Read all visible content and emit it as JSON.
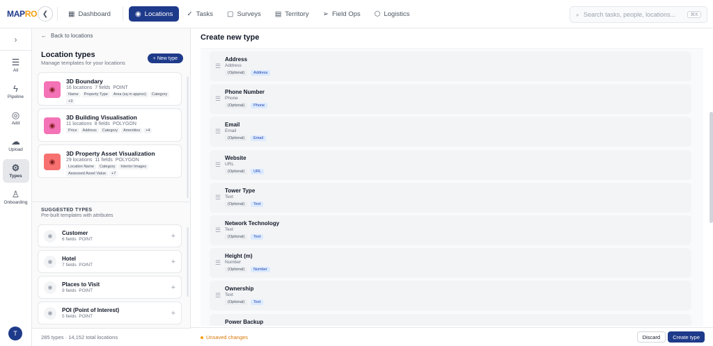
{
  "brand": {
    "logo_main": "MAP",
    "logo_accent": "RO"
  },
  "nav": {
    "back_icon": "chevron-left-icon",
    "tabs": [
      {
        "label": "Dashboard",
        "icon": "dashboard-icon",
        "active": false
      },
      {
        "label": "Locations",
        "icon": "location-pin-icon",
        "active": true
      },
      {
        "label": "Tasks",
        "icon": "check-icon",
        "active": false
      },
      {
        "label": "Surveys",
        "icon": "clipboard-icon",
        "active": false
      },
      {
        "label": "Territory",
        "icon": "map-icon",
        "active": false
      },
      {
        "label": "Field Ops",
        "icon": "send-icon",
        "active": false
      },
      {
        "label": "Logistics",
        "icon": "box-icon",
        "active": false
      }
    ]
  },
  "search": {
    "placeholder": "Search tasks, people, locations...",
    "shortcut": "⌘K"
  },
  "rail": {
    "items": [
      {
        "label": "All",
        "icon": "list-icon"
      },
      {
        "label": "Pipeline",
        "icon": "bolt-icon"
      },
      {
        "label": "Add",
        "icon": "pin-add-icon"
      },
      {
        "label": "Upload",
        "icon": "cloud-upload-icon"
      },
      {
        "label": "Types",
        "icon": "gear-icon"
      },
      {
        "label": "Onboarding",
        "icon": "user-add-icon"
      }
    ],
    "avatar": "T"
  },
  "left_panel": {
    "back_label": "Back to locations",
    "title": "Location types",
    "subtitle": "Manage templates for your locations",
    "new_type_label": "+ New type",
    "types": [
      {
        "name": "3D Boundary",
        "locations": "16 locations",
        "fields": "7 fields",
        "geometry": "POINT",
        "chips": [
          "Name",
          "Property Type",
          "Area (sq m approx)",
          "Category",
          "+3"
        ],
        "color": "#f472b6"
      },
      {
        "name": "3D Building Visualisation",
        "locations": "11 locations",
        "fields": "8 fields",
        "geometry": "POLYGON",
        "chips": [
          "Price",
          "Address",
          "Category",
          "Amenities",
          "+4"
        ],
        "color": "#f472b6"
      },
      {
        "name": "3D Property Asset Visualization",
        "locations": "29 locations",
        "fields": "11 fields",
        "geometry": "POLYGON",
        "chips": [
          "Location Name",
          "Category",
          "Interior Images",
          "Assessed Asset Value",
          "+7"
        ],
        "color": "#f87171"
      }
    ],
    "suggested_title": "SUGGESTED TYPES",
    "suggested_subtitle": "Pre-built templates with attributes",
    "suggested": [
      {
        "name": "Customer",
        "fields": "6 fields",
        "geometry": "POINT"
      },
      {
        "name": "Hotel",
        "fields": "7 fields",
        "geometry": "POINT"
      },
      {
        "name": "Places to Visit",
        "fields": "9 fields",
        "geometry": "POINT"
      },
      {
        "name": "POI (Point of Interest)",
        "fields": "5 fields",
        "geometry": "POINT"
      }
    ],
    "footer": "285 types · 14,152 total locations"
  },
  "main": {
    "title": "Create new type",
    "fields": [
      {
        "name": "Address",
        "type": "Address",
        "optional": "(Optional)",
        "tag": "Address"
      },
      {
        "name": "Phone Number",
        "type": "Phone",
        "optional": "(Optional)",
        "tag": "Phone"
      },
      {
        "name": "Email",
        "type": "Email",
        "optional": "(Optional)",
        "tag": "Email"
      },
      {
        "name": "Website",
        "type": "URL",
        "optional": "(Optional)",
        "tag": "URL"
      },
      {
        "name": "Tower Type",
        "type": "Text",
        "optional": "(Optional)",
        "tag": "Text"
      },
      {
        "name": "Network Technology",
        "type": "Text",
        "optional": "(Optional)",
        "tag": "Text"
      },
      {
        "name": "Height (m)",
        "type": "Number",
        "optional": "(Optional)",
        "tag": "Number"
      },
      {
        "name": "Ownership",
        "type": "Text",
        "optional": "(Optional)",
        "tag": "Text"
      },
      {
        "name": "Power Backup",
        "type": "",
        "optional": "",
        "tag": ""
      }
    ],
    "unsaved": "Unsaved changes",
    "discard_label": "Discard",
    "create_label": "Create type"
  }
}
